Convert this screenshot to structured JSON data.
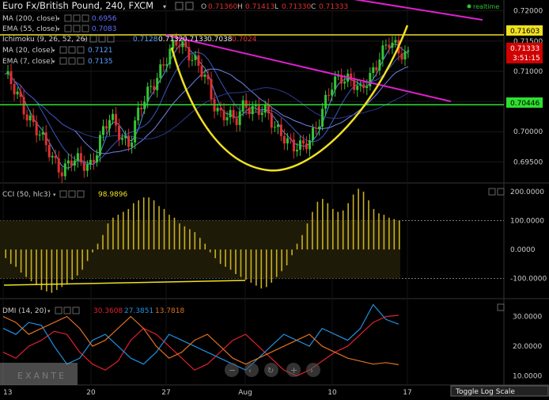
{
  "header": {
    "symbol_title": "Euro Fx/British Pound, 240, FXCM",
    "ohlc": [
      {
        "label": "O",
        "value": "0.71360"
      },
      {
        "label": "H",
        "value": "0.71413"
      },
      {
        "label": "L",
        "value": "0.71330"
      },
      {
        "label": "C",
        "value": "0.71333"
      }
    ],
    "realtime": "realtime"
  },
  "studies": [
    {
      "label": "MA (200, close)",
      "values": [
        "0.6956"
      ]
    },
    {
      "label": "EMA (55, close)",
      "values": [
        "0.7083"
      ]
    },
    {
      "label": "Ichimoku (9, 26, 52, 26)",
      "values": [
        "0.7128",
        "0.7132",
        "0.7133",
        "0.7038",
        "0.7024"
      ]
    },
    {
      "label": "MA (20, close)",
      "values": [
        "0.7121"
      ]
    },
    {
      "label": "EMA (7, close)",
      "values": [
        "0.7135"
      ]
    }
  ],
  "cci_panel": {
    "label": "CCI (50, hlc3)",
    "value": "98.9896"
  },
  "dmi_panel": {
    "label": "DMI (14, 20)",
    "values": [
      "30.3608",
      "27.3851",
      "13.7818"
    ]
  },
  "colors": {
    "up": "#35c435",
    "down": "#e03030",
    "yellow": "#f0e020",
    "magenta": "#e020d0",
    "green_line": "#2ee02e",
    "cci_bar": "#c8b020",
    "dmi_red": "#e02030",
    "dmi_blue": "#2090e0",
    "dmi_orange": "#e07020",
    "price_tag": "#d00000"
  },
  "price_tags": {
    "current_price": "0.71333",
    "countdown": "3:51:15"
  },
  "level_tags": [
    "0.71603",
    "0.70446"
  ],
  "toggle_log_scale": "Toggle Log Scale",
  "watermark": "EXANTE",
  "chart_data": [
    {
      "type": "candlestick",
      "title": "Euro Fx/British Pound, 240, FXCM",
      "x_ticks": [
        "13",
        "20",
        "27",
        "Aug",
        "10",
        "17"
      ],
      "y_ticks": [
        "0.72000",
        "0.71500",
        "0.71000",
        "0.70500",
        "0.70000",
        "0.69500"
      ],
      "ylim": [
        0.6915,
        0.7218
      ],
      "close_path": [
        0.7095,
        0.7065,
        0.704,
        0.7015,
        0.698,
        0.6955,
        0.694,
        0.695,
        0.6945,
        0.695,
        0.699,
        0.702,
        0.7,
        0.698,
        0.703,
        0.707,
        0.71,
        0.712,
        0.715,
        0.714,
        0.711,
        0.708,
        0.704,
        0.703,
        0.701,
        0.705,
        0.704,
        0.703,
        0.701,
        0.7,
        0.697,
        0.697,
        0.7,
        0.703,
        0.707,
        0.7095,
        0.709,
        0.706,
        0.709,
        0.713,
        0.7145,
        0.713,
        0.7133
      ],
      "horizontal_levels": [
        0.71603,
        0.70446
      ],
      "trendlines": [
        {
          "color": "magenta",
          "from": [
            "27",
            0.716
          ],
          "to": [
            "17",
            0.705
          ]
        },
        {
          "color": "magenta",
          "from": [
            "10",
            0.7225
          ],
          "to": [
            "17",
            0.7185
          ]
        }
      ],
      "cup_curve": "yellow"
    },
    {
      "type": "bar",
      "title": "CCI (50, hlc3)",
      "y_ticks": [
        "200.0000",
        "100.0000",
        "0.0000",
        "-100.0000"
      ],
      "ylim": [
        -170,
        230
      ],
      "levels": [
        100,
        -100
      ],
      "values": [
        -30,
        -50,
        -60,
        -80,
        -95,
        -110,
        -120,
        -140,
        -145,
        -150,
        -140,
        -130,
        -120,
        -105,
        -90,
        -70,
        -40,
        -10,
        20,
        50,
        90,
        110,
        120,
        130,
        140,
        160,
        170,
        180,
        180,
        170,
        150,
        140,
        120,
        110,
        90,
        80,
        70,
        60,
        40,
        20,
        -10,
        -30,
        -50,
        -60,
        -70,
        -85,
        -95,
        -105,
        -115,
        -125,
        -135,
        -130,
        -115,
        -95,
        -75,
        -55,
        -20,
        20,
        50,
        90,
        130,
        165,
        175,
        160,
        140,
        130,
        135,
        160,
        190,
        210,
        200,
        170,
        140,
        125,
        120,
        110,
        105,
        100
      ]
    },
    {
      "type": "line",
      "title": "DMI (14, 20)",
      "y_ticks": [
        "30.0000",
        "20.0000",
        "10.0000"
      ],
      "ylim": [
        7,
        36
      ],
      "series": [
        {
          "name": "30.3608",
          "color": "dmi_red",
          "values": [
            18,
            16,
            20,
            22,
            25,
            24,
            18,
            14,
            12,
            15,
            22,
            26,
            24,
            20,
            16,
            12,
            14,
            18,
            22,
            24,
            20,
            16,
            12,
            10,
            12,
            15,
            18,
            20,
            24,
            28,
            30,
            30.4
          ]
        },
        {
          "name": "27.3851",
          "color": "dmi_blue",
          "values": [
            26,
            24,
            28,
            27,
            20,
            14,
            16,
            22,
            24,
            20,
            16,
            14,
            18,
            24,
            22,
            20,
            18,
            16,
            14,
            12,
            16,
            20,
            24,
            22,
            20,
            26,
            24,
            22,
            26,
            34,
            29,
            27.4
          ]
        },
        {
          "name": "13.7818",
          "color": "dmi_orange",
          "values": [
            30,
            28,
            24,
            26,
            28,
            30,
            26,
            20,
            22,
            26,
            30,
            26,
            20,
            16,
            18,
            22,
            24,
            20,
            16,
            14,
            16,
            18,
            20,
            22,
            24,
            20,
            18,
            16,
            15,
            14,
            14.5,
            13.8
          ]
        }
      ]
    }
  ]
}
